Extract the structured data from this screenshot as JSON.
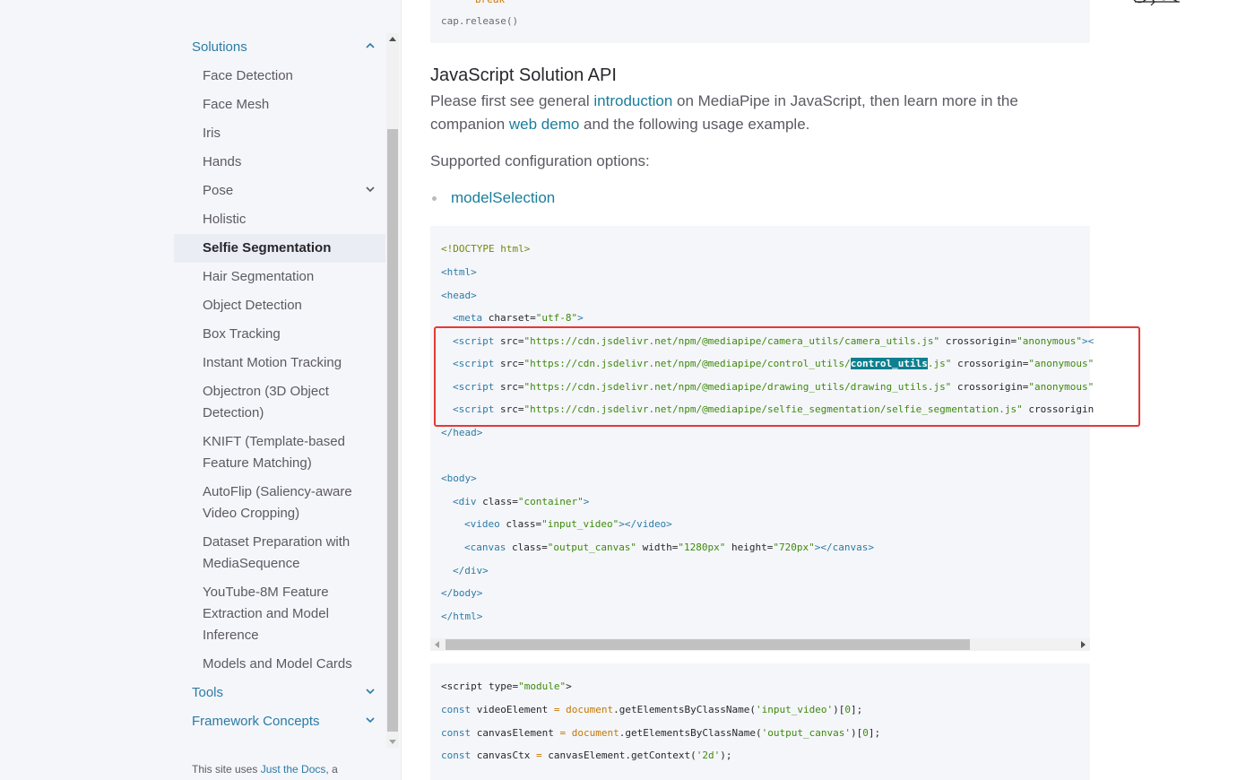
{
  "sidebar": {
    "items": [
      {
        "label": "Solutions",
        "level": "top",
        "chevron": "up"
      },
      {
        "label": "Face Detection"
      },
      {
        "label": "Face Mesh"
      },
      {
        "label": "Iris"
      },
      {
        "label": "Hands"
      },
      {
        "label": "Pose",
        "chevron": "down"
      },
      {
        "label": "Holistic"
      },
      {
        "label": "Selfie Segmentation",
        "active": true
      },
      {
        "label": "Hair Segmentation"
      },
      {
        "label": "Object Detection"
      },
      {
        "label": "Box Tracking"
      },
      {
        "label": "Instant Motion Tracking"
      },
      {
        "label": "Objectron (3D Object Detection)"
      },
      {
        "label": "KNIFT (Template-based Feature Matching)"
      },
      {
        "label": "AutoFlip (Saliency-aware Video Cropping)"
      },
      {
        "label": "Dataset Preparation with MediaSequence"
      },
      {
        "label": "YouTube-8M Feature Extraction and Model Inference"
      },
      {
        "label": "Models and Model Cards"
      },
      {
        "label": "Tools",
        "level": "top",
        "chevron": "down"
      },
      {
        "label": "Framework Concepts",
        "level": "top",
        "chevron": "down"
      }
    ],
    "footer_prefix": "This site uses ",
    "footer_link": "Just the Docs",
    "footer_suffix": ", a"
  },
  "top_code": {
    "partial_line": "break",
    "last_line": "cap.release()"
  },
  "main": {
    "heading": "JavaScript Solution API",
    "intro_1": "Please first see general ",
    "intro_link_1": "introduction",
    "intro_2": " on MediaPipe in JavaScript, then learn more in the",
    "intro_3": "companion ",
    "intro_link_2": "web demo",
    "intro_4": " and the following usage example.",
    "config_label": "Supported configuration options:",
    "bullet_link": "modelSelection"
  },
  "html_code": {
    "doctype": "<!DOCTYPE html>",
    "html_open": "<html>",
    "head_open": "<head>",
    "meta_tag": "<meta",
    "meta_attr": " charset=",
    "meta_val": "\"utf-8\"",
    "meta_close": ">",
    "scripts": [
      {
        "url_a": "\"https://cdn.jsdelivr.net/npm/@mediapipe/camera_utils/camera_utils.js\"",
        "url_hl": "",
        "url_b": "",
        "tail": " crossorigin=",
        "tail_val": "\"anonymous\"",
        "end": "><"
      },
      {
        "url_a": "\"https://cdn.jsdelivr.net/npm/@mediapipe/control_utils/",
        "url_hl": "control_utils",
        "url_b": ".js\"",
        "tail": " crossorigin=",
        "tail_val": "\"anonymous\"",
        "end": ""
      },
      {
        "url_a": "\"https://cdn.jsdelivr.net/npm/@mediapipe/drawing_utils/drawing_utils.js\"",
        "url_hl": "",
        "url_b": "",
        "tail": " crossorigin=",
        "tail_val": "\"anonymous\"",
        "end": ""
      },
      {
        "url_a": "\"https://cdn.jsdelivr.net/npm/@mediapipe/selfie_segmentation/selfie_segmentation.js\"",
        "url_hl": "",
        "url_b": "",
        "tail": " crossorigin",
        "tail_val": "",
        "end": ""
      }
    ],
    "script_tag": "<script",
    "src_attr": " src=",
    "head_close": "</head>",
    "body_open": "<body>",
    "div_open": "<div",
    "class_attr": " class=",
    "div_class": "\"container\"",
    "gt": ">",
    "video_open": "<video",
    "video_class": "\"input_video\"",
    "video_close": "></video>",
    "canvas_open": "<canvas",
    "canvas_class": "\"output_canvas\"",
    "width_attr": " width=",
    "width_val": "\"1280px\"",
    "height_attr": " height=",
    "height_val": "\"720px\"",
    "canvas_close": "></canvas>",
    "div_close": "</div>",
    "body_close": "</body>",
    "html_close": "</html>"
  },
  "js_code": {
    "script_open": "<script",
    "type_attr": " type=",
    "type_val": "\"module\"",
    "gt": ">",
    "const": "const",
    "video_var": " videoElement ",
    "canvas_var": " canvasElement ",
    "ctx_var": " canvasCtx ",
    "eq": "=",
    "document": " document",
    "get_by_class": ".getElementsByClassName(",
    "arg_video": "'input_video'",
    "arg_canvas": "'output_canvas'",
    "idx_open": ")[",
    "idx_zero": "0",
    "idx_close": "];",
    "ctx_expr": " canvasElement.getContext(",
    "arg_2d": "'2d'",
    "ctx_close": ");"
  },
  "colors": {
    "link": "#1a7e9a",
    "nav_top": "#2b7ba6",
    "highlight_box": "#e53935",
    "selection": "#0e7f8f"
  }
}
